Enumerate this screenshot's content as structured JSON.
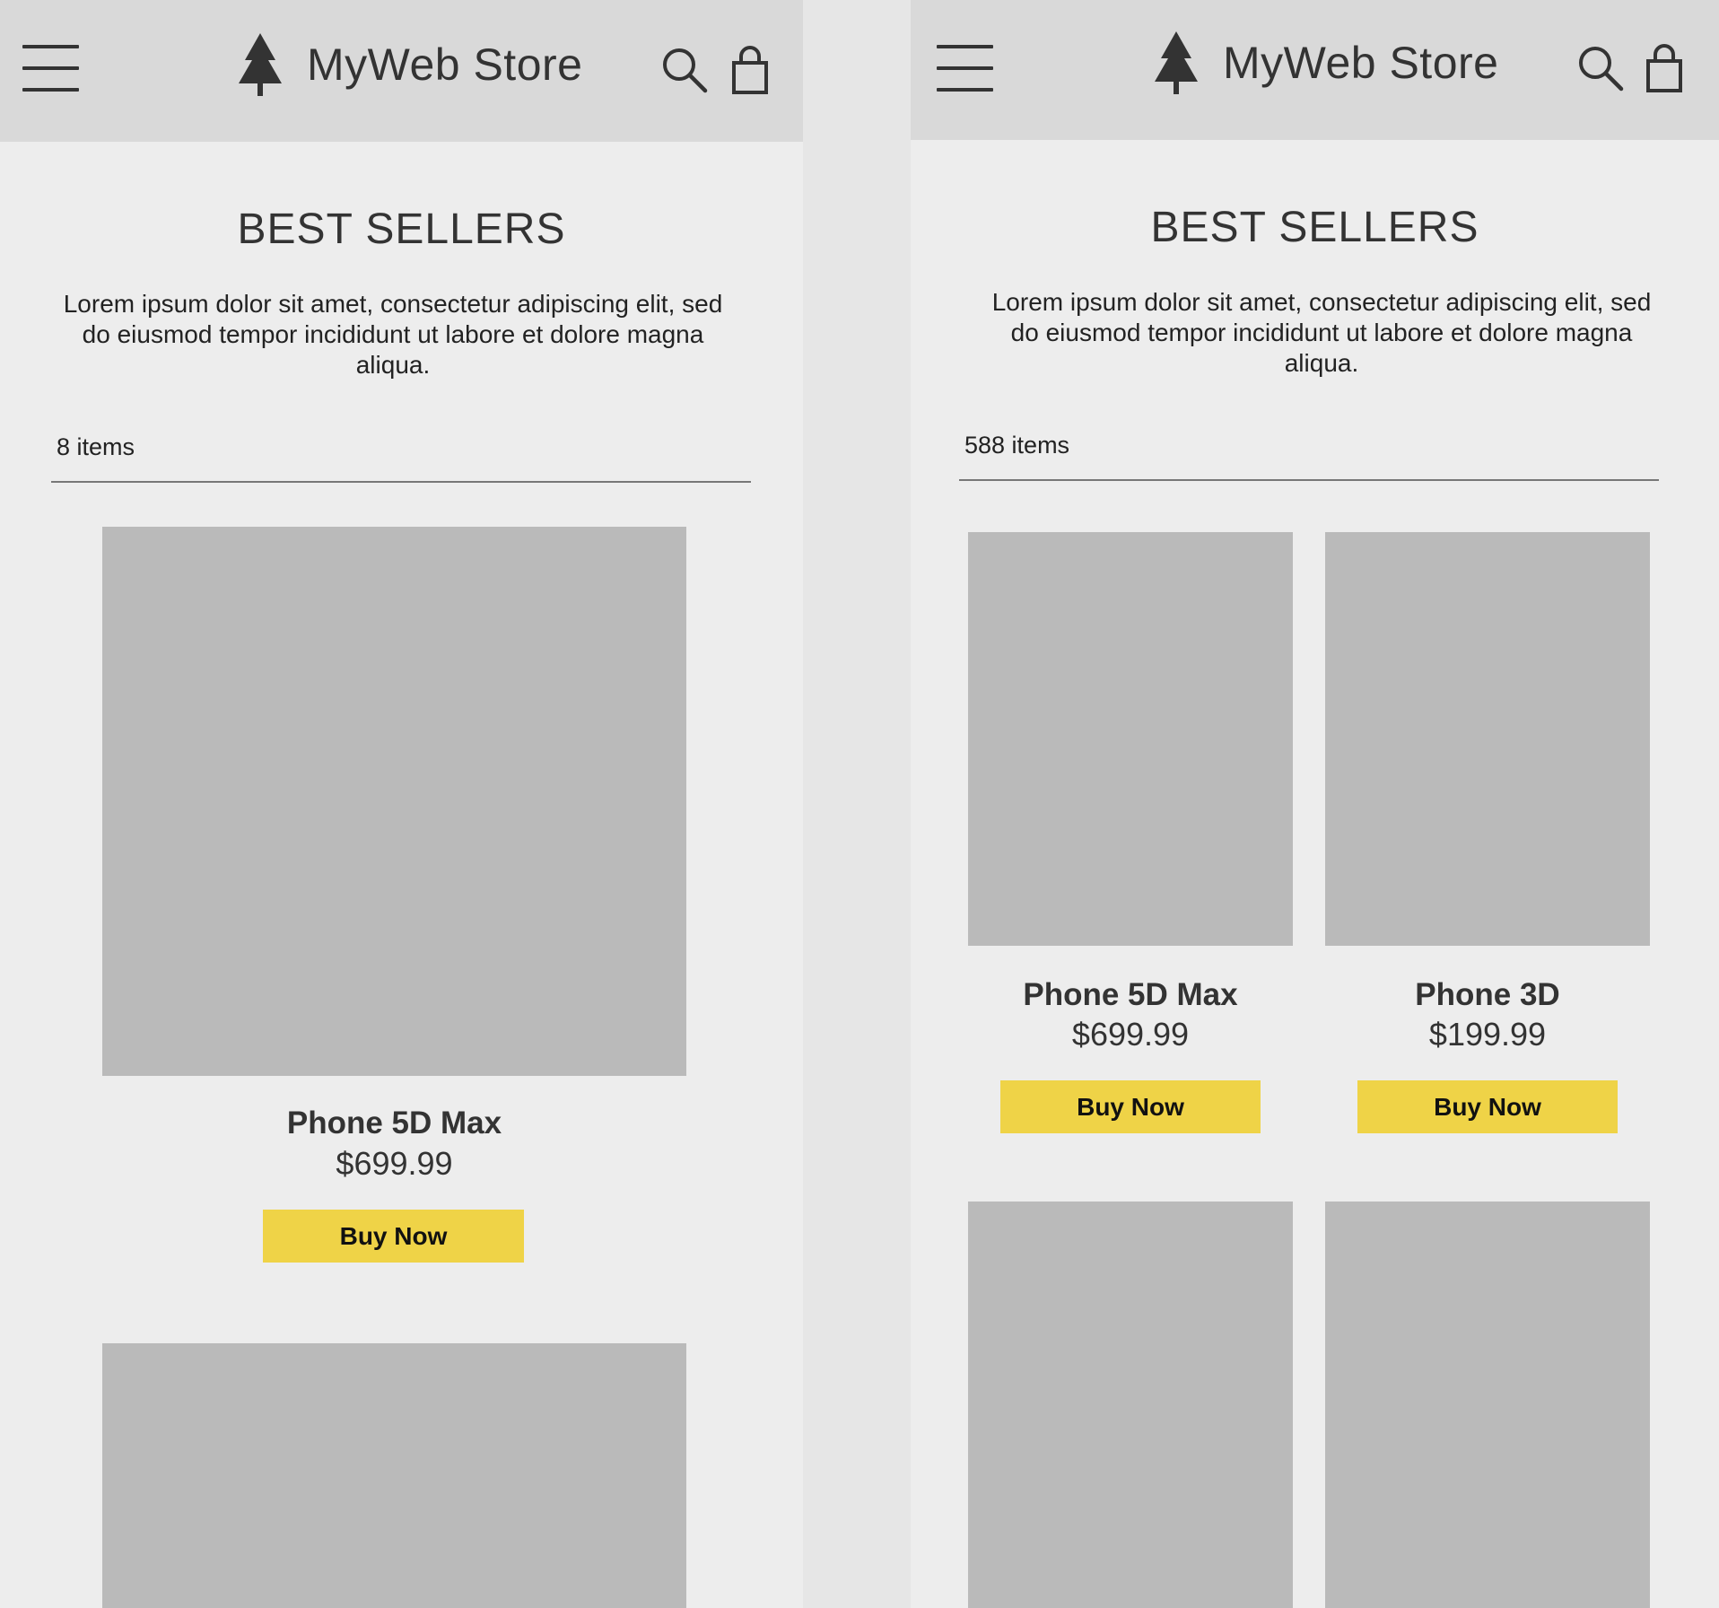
{
  "colors": {
    "page_background": "#e6e6e6",
    "panel_background": "#ededed",
    "header_background": "#d9d9d9",
    "image_placeholder": "#bababa",
    "buy_button": "#efd347",
    "text": "#333333"
  },
  "icons": {
    "menu": "hamburger-menu-icon",
    "logo": "pine-tree-icon",
    "search": "magnifier-search-icon",
    "bag": "shopping-bag-icon"
  },
  "mobile": {
    "header": {
      "brand": "MyWeb Store"
    },
    "section": {
      "title": "BEST SELLERS",
      "intro": "Lorem ipsum dolor sit amet, consectetur adipiscing elit, sed do eiusmod tempor incididunt ut labore et dolore magna aliqua.",
      "item_count": "8 items"
    },
    "products": [
      {
        "name": "Phone 5D Max",
        "price": "$699.99",
        "button": "Buy Now"
      }
    ]
  },
  "tablet": {
    "header": {
      "brand": "MyWeb Store"
    },
    "section": {
      "title": "BEST SELLERS",
      "intro": "Lorem ipsum dolor sit amet, consectetur adipiscing elit, sed do eiusmod tempor incididunt ut labore et dolore magna aliqua.",
      "item_count": "588 items"
    },
    "products": [
      {
        "name": "Phone 5D Max",
        "price": "$699.99",
        "button": "Buy Now"
      },
      {
        "name": "Phone 3D",
        "price": "$199.99",
        "button": "Buy Now"
      }
    ]
  }
}
